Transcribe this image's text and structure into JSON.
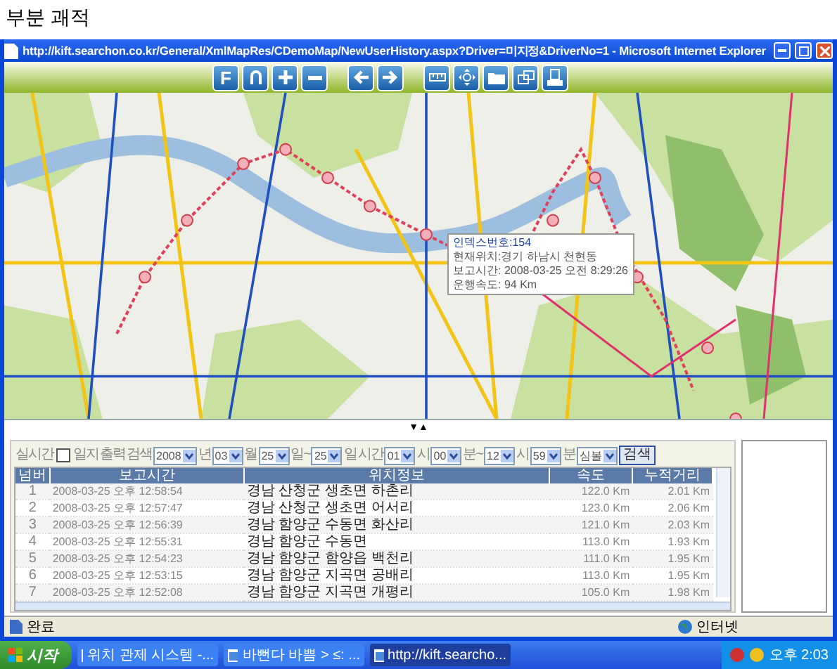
{
  "page_title": "부분 괘적",
  "window": {
    "title": "http://kift.searchon.co.kr/General/XmlMapRes/CDemoMap/NewUserHistory.aspx?Driver=미지정&DriverNo=1 - Microsoft Internet Explorer"
  },
  "toolbar": {
    "buttons": [
      {
        "kind": "letter",
        "label": "F"
      },
      {
        "kind": "back"
      },
      {
        "kind": "zoom-in"
      },
      {
        "kind": "zoom-out"
      },
      {
        "kind": "left"
      },
      {
        "kind": "right"
      },
      {
        "kind": "measure"
      },
      {
        "kind": "pan"
      },
      {
        "kind": "folder"
      },
      {
        "kind": "layers"
      },
      {
        "kind": "print"
      }
    ]
  },
  "map": {
    "tooltip": {
      "title": "인덱스번호:154",
      "lines": [
        "현재위치:경기 하남시 천현동",
        "보고시간: 2008-03-25 오전 8:29:26",
        "운행속도: 94 Km"
      ]
    },
    "splitter": "▼▲"
  },
  "search_form": {
    "items": [
      {
        "kind": "label",
        "text": "실시간"
      },
      {
        "kind": "checkbox",
        "text": "일지",
        "checked": false
      },
      {
        "kind": "label",
        "text": "출력"
      },
      {
        "kind": "label",
        "text": "검색"
      },
      {
        "kind": "select",
        "value": "2008"
      },
      {
        "kind": "label",
        "text": "년"
      },
      {
        "kind": "select",
        "value": "03"
      },
      {
        "kind": "label",
        "text": "월"
      },
      {
        "kind": "select",
        "value": "25"
      },
      {
        "kind": "label",
        "text": "일~"
      },
      {
        "kind": "select",
        "value": "25"
      },
      {
        "kind": "label",
        "text": "일"
      },
      {
        "kind": "label",
        "text": "시간"
      },
      {
        "kind": "select",
        "value": "01"
      },
      {
        "kind": "label",
        "text": "시"
      },
      {
        "kind": "select",
        "value": "00"
      },
      {
        "kind": "label",
        "text": "분~"
      },
      {
        "kind": "select",
        "value": "12"
      },
      {
        "kind": "label",
        "text": "시"
      },
      {
        "kind": "select",
        "value": "59"
      },
      {
        "kind": "label",
        "text": "분"
      },
      {
        "kind": "select",
        "value": "심볼"
      },
      {
        "kind": "button",
        "text": "검색"
      }
    ]
  },
  "table": {
    "columns": [
      "넘버",
      "보고시간",
      "위치정보",
      "속도",
      "누적거리"
    ],
    "rows": [
      [
        "1",
        "2008-03-25 오후 12:58:54",
        "경남 산청군 생초면 하촌리",
        "122.0 Km",
        "2.01 Km"
      ],
      [
        "2",
        "2008-03-25 오후 12:57:47",
        "경남 산청군 생초면 어서리",
        "123.0 Km",
        "2.06 Km"
      ],
      [
        "3",
        "2008-03-25 오후 12:56:39",
        "경남 함양군 수동면 화산리",
        "121.0 Km",
        "2.03 Km"
      ],
      [
        "4",
        "2008-03-25 오후 12:55:31",
        "경남 함양군 수동면",
        "113.0 Km",
        "1.93 Km"
      ],
      [
        "5",
        "2008-03-25 오후 12:54:23",
        "경남 함양군 함양읍 백천리",
        "111.0 Km",
        "1.95 Km"
      ],
      [
        "6",
        "2008-03-25 오후 12:53:15",
        "경남 함양군 지곡면 공배리",
        "113.0 Km",
        "1.95 Km"
      ],
      [
        "7",
        "2008-03-25 오후 12:52:08",
        "경남 함양군 지곡면 개평리",
        "105.0 Km",
        "1.98 Km"
      ]
    ]
  },
  "status_bar": {
    "text": "완료",
    "zone": "인터넷"
  },
  "taskbar": {
    "start": "시작",
    "tasks": [
      {
        "label": "위치 관제 시스템 -...",
        "selected": false
      },
      {
        "label": "바뻔다 바쁨 > ≤: ...",
        "selected": false
      },
      {
        "label": "http://kift.searcho...",
        "selected": true
      }
    ],
    "clock": "오후 2:03"
  }
}
